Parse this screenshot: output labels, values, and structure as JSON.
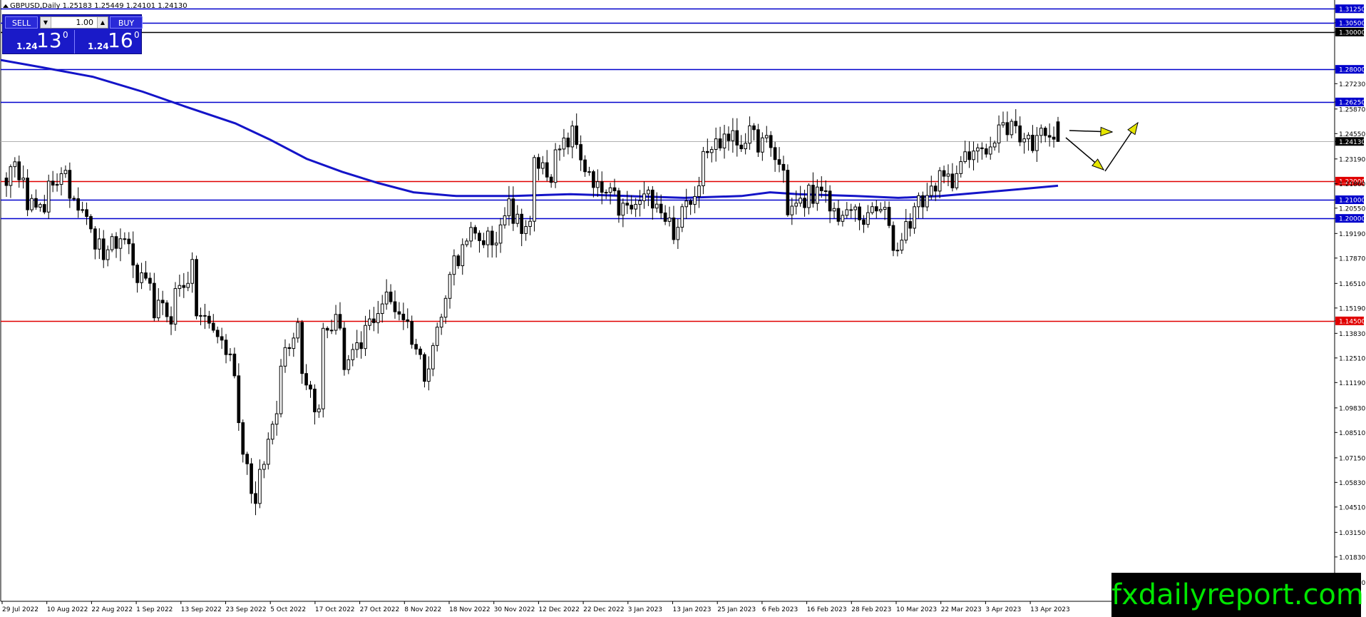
{
  "header": {
    "symbol_line": "GBPUSD,Daily  1.25183 1.25449 1.24101 1.24130"
  },
  "trade_panel": {
    "sell_label": "SELL",
    "buy_label": "BUY",
    "lot_value": "1.00",
    "sell_small": "1.24",
    "sell_big": "13",
    "sell_sup": "0",
    "buy_small": "1.24",
    "buy_big": "16",
    "buy_sup": "0"
  },
  "logo_text": "fxdailyreport.com",
  "colors": {
    "blue_level": "#0000cc",
    "red_level": "#e00000",
    "black_level": "#000000",
    "ma_line": "#1414c8",
    "arrows": "#e6e600",
    "current_price": "#000000"
  },
  "chart_data": {
    "type": "candlestick",
    "title": "GBPUSD,Daily",
    "ohlc_header": {
      "open": 1.25183,
      "high": 1.25449,
      "low": 1.24101,
      "close": 1.2413
    },
    "ylim": [
      0.9945,
      1.3172
    ],
    "y_ticks": [
      "1.31250",
      "1.30500",
      "1.30000",
      "1.28000",
      "1.27230",
      "1.26250",
      "1.25870",
      "1.24550",
      "1.24130",
      "1.23190",
      "1.22000",
      "1.21860",
      "1.21000",
      "1.20550",
      "1.20000",
      "1.19190",
      "1.17870",
      "1.16510",
      "1.15190",
      "1.14500",
      "1.13830",
      "1.12510",
      "1.11190",
      "1.09830",
      "1.08510",
      "1.07150",
      "1.05830",
      "1.04510",
      "1.03150",
      "1.01830",
      "1.00470"
    ],
    "x_labels": [
      "29 Jul 2022",
      "10 Aug 2022",
      "22 Aug 2022",
      "1 Sep 2022",
      "13 Sep 2022",
      "23 Sep 2022",
      "5 Oct 2022",
      "17 Oct 2022",
      "27 Oct 2022",
      "8 Nov 2022",
      "18 Nov 2022",
      "30 Nov 2022",
      "12 Dec 2022",
      "22 Dec 2022",
      "3 Jan 2023",
      "13 Jan 2023",
      "25 Jan 2023",
      "6 Feb 2023",
      "16 Feb 2023",
      "28 Feb 2023",
      "10 Mar 2023",
      "22 Mar 2023",
      "3 Apr 2023",
      "13 Apr 2023"
    ],
    "levels": [
      {
        "value": 1.3125,
        "label": "1.31250",
        "color": "blue"
      },
      {
        "value": 1.305,
        "label": "1.30500",
        "color": "blue"
      },
      {
        "value": 1.3,
        "label": "1.30000",
        "color": "black"
      },
      {
        "value": 1.28,
        "label": "1.28000",
        "color": "blue"
      },
      {
        "value": 1.2625,
        "label": "1.26250",
        "color": "blue"
      },
      {
        "value": 1.22,
        "label": "1.22000",
        "color": "red"
      },
      {
        "value": 1.21,
        "label": "1.21000",
        "color": "blue"
      },
      {
        "value": 1.2,
        "label": "1.20000",
        "color": "blue"
      },
      {
        "value": 1.145,
        "label": "1.14500",
        "color": "red"
      }
    ],
    "current_price": {
      "value": 1.2413,
      "label": "1.24130"
    },
    "waypoints": [
      [
        1.2225,
        1.2275
      ],
      [
        1.21,
        1.2
      ],
      [
        1.222,
        1.22
      ],
      [
        1.215,
        1.205
      ],
      [
        1.19,
        1.178
      ],
      [
        1.185,
        1.19
      ],
      [
        1.17,
        1.16
      ],
      [
        1.152,
        1.148
      ],
      [
        1.16,
        1.172
      ],
      [
        1.15,
        1.14
      ],
      [
        1.138,
        1.12
      ],
      [
        1.09,
        1.045
      ],
      [
        1.06,
        1.1
      ],
      [
        1.125,
        1.145
      ],
      [
        1.12,
        1.095
      ],
      [
        1.14,
        1.145
      ],
      [
        1.12,
        1.13
      ],
      [
        1.14,
        1.155
      ],
      [
        1.157,
        1.148
      ],
      [
        1.143,
        1.118
      ],
      [
        1.125,
        1.155
      ],
      [
        1.175,
        1.185
      ],
      [
        1.19,
        1.19
      ],
      [
        1.18,
        1.215
      ],
      [
        1.2,
        1.195
      ],
      [
        1.23,
        1.225
      ],
      [
        1.232,
        1.245
      ],
      [
        1.24,
        1.215
      ],
      [
        1.215,
        1.21
      ],
      [
        1.205,
        1.205
      ],
      [
        1.21,
        1.212
      ],
      [
        1.205,
        1.19
      ],
      [
        1.205,
        1.22
      ],
      [
        1.24,
        1.24
      ],
      [
        1.245,
        1.24
      ],
      [
        1.245,
        1.24
      ],
      [
        1.24,
        1.225
      ],
      [
        1.205,
        1.208
      ],
      [
        1.215,
        1.21
      ],
      [
        1.205,
        1.2
      ],
      [
        1.205,
        1.198
      ],
      [
        1.205,
        1.2
      ],
      [
        1.182,
        1.2
      ],
      [
        1.205,
        1.215
      ],
      [
        1.22,
        1.22
      ],
      [
        1.23,
        1.232
      ],
      [
        1.24,
        1.24
      ],
      [
        1.248,
        1.25
      ],
      [
        1.245,
        1.24
      ],
      [
        1.252,
        1.2413
      ]
    ]
  }
}
